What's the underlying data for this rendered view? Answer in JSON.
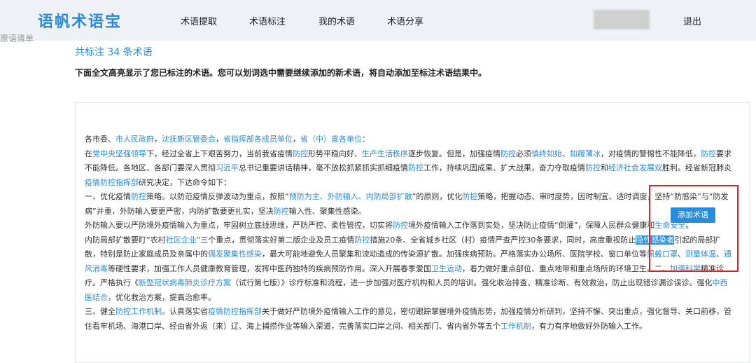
{
  "app": {
    "logo": "语帆术语宝"
  },
  "nav": [
    {
      "label": "术语提取"
    },
    {
      "label": "术语标注"
    },
    {
      "label": "我的术语"
    },
    {
      "label": "术语分享"
    }
  ],
  "header": {
    "logout": "退出"
  },
  "sidebar": {
    "fragment": "原语清单"
  },
  "summary": {
    "count_text": "共标注 34 条术语",
    "instruction": "下面全文高亮显示了您已标注的术语。您可以划词选中需要继续添加的新术语，将自动添加至标注术语结果中。"
  },
  "popup": {
    "add_button": "添加术语"
  },
  "colors": {
    "accent": "#2b8bd8",
    "highlight_box": "#e02020",
    "header_bg": "#eef1f6"
  },
  "document": {
    "paragraphs": [
      [
        {
          "t": "各市委、"
        },
        {
          "t": "市人民政府",
          "h": true
        },
        {
          "t": "，"
        },
        {
          "t": "沈抚新区管委会",
          "h": true
        },
        {
          "t": "，"
        },
        {
          "t": "省指挥部各成员单位",
          "h": true
        },
        {
          "t": "，"
        },
        {
          "t": "省（中）直各单位",
          "h": true
        },
        {
          "t": "："
        }
      ],
      [
        {
          "t": "在"
        },
        {
          "t": "党中央坚强领导",
          "h": true
        },
        {
          "t": "下，经过全省上下艰苦努力，当前我省疫情"
        },
        {
          "t": "防控",
          "h": true
        },
        {
          "t": "形势平稳向好、"
        },
        {
          "t": "生产生活秩序",
          "h": true
        },
        {
          "t": "逐步恢复。但是，加强疫情"
        },
        {
          "t": "防控",
          "h": true
        },
        {
          "t": "必须"
        },
        {
          "t": "慎终如始",
          "h": true
        },
        {
          "t": "、"
        },
        {
          "t": "如履薄冰",
          "h": true
        },
        {
          "t": "，对疫情的警惕性不能降低，"
        },
        {
          "t": "防控",
          "h": true
        },
        {
          "t": "要求不能降低。各地区、各部门要深入贯彻"
        },
        {
          "t": "习近平",
          "h": true
        },
        {
          "t": "总书记重要讲话精神，毫不放松抓紧抓实抓细疫情"
        },
        {
          "t": "防控",
          "h": true
        },
        {
          "t": "工作，持续巩固成果、扩大战果，奋力夺取疫情"
        },
        {
          "t": "防控",
          "h": true
        },
        {
          "t": "和"
        },
        {
          "t": "经济社会发展双",
          "h": true
        },
        {
          "t": "胜利。经省新冠肺炎"
        },
        {
          "t": "疫情防控指挥部",
          "h": true
        },
        {
          "t": "研究决定，下达命令如下："
        }
      ],
      [
        {
          "t": "一、优化疫情"
        },
        {
          "t": "防控",
          "h": true
        },
        {
          "t": "策略。以防范疫情反弹波动为重点，按照“"
        },
        {
          "t": "预防为主、外防输入、内防局部扩散",
          "h": true
        },
        {
          "t": "”的原则，优化"
        },
        {
          "t": "防控",
          "h": true
        },
        {
          "t": "策略，把握动态、审时度势，因时制宜、适时调度，坚持“防感染”与“防发病”并重，外防输入要更严密，内防扩散要更扎实，坚决"
        },
        {
          "t": "防控",
          "h": true
        },
        {
          "t": "输入性、聚集性感染。"
        }
      ],
      [
        {
          "t": "外防输入要以严防境外疫情输入为重点，牢固树立底线思维，严防严控、柔性管控，切实将"
        },
        {
          "t": "防控",
          "h": true
        },
        {
          "t": "境外疫情输入工作落到实处，坚决防止疫情“倒灌”，保障人民群众健康和"
        },
        {
          "t": "生命安全",
          "h": true
        },
        {
          "t": "。"
        }
      ],
      [
        {
          "t": "内防局部扩散要盯“农村"
        },
        {
          "t": "社区企业",
          "h": true
        },
        {
          "t": "”三个重点，贯彻落实好第二版企业及员工疫情"
        },
        {
          "t": "防控",
          "h": true
        },
        {
          "t": "措施20条、全省城乡社区（村）疫情严查严控30条要求，同时，高度重视防止"
        },
        {
          "t": "隐性感染者",
          "s": true
        },
        {
          "t": "引起的局部扩散，特别是防止家庭成员及亲属中的"
        },
        {
          "t": "偶发聚集性感染",
          "h": true
        },
        {
          "t": "，最大可能地避免人员聚集和流动造成的传染源扩散。加强疾病预防。严格落实办公场所、医院学校、窗口单位等"
        },
        {
          "t": "佩戴口罩",
          "h": true
        },
        {
          "t": "、"
        },
        {
          "t": "测量体温",
          "h": true
        },
        {
          "t": "、"
        },
        {
          "t": "通风消毒",
          "h": true
        },
        {
          "t": "等硬性要求，加强工作人员健康教育管理，发挥中医药独特的疾病预防作用。深入开展春季爱国"
        },
        {
          "t": "卫生运动",
          "h": true
        },
        {
          "t": "，着力做好重点部位、重点地带和重点场所的环境卫生。二、"
        },
        {
          "t": "加强科学",
          "h": true
        },
        {
          "t": "精准诊疗。严格执行《"
        },
        {
          "t": "新型冠状病毒肺炎诊疗方案",
          "h": true
        },
        {
          "t": "（试行第七版）》诊疗标准和流程，进一步加强对医疗机构和人员的培训。强化收治排查、精准诊断、有效救治，防止出现错诊漏诊误诊。强化"
        },
        {
          "t": "中西医结合",
          "h": true
        },
        {
          "t": "，优化救治方案，提高治愈率。"
        }
      ],
      [
        {
          "t": "三、健全"
        },
        {
          "t": "防控工作机制",
          "h": true
        },
        {
          "t": "。认真落实省"
        },
        {
          "t": "疫情防控指挥部",
          "h": true
        },
        {
          "t": "关于做好严防境外疫情输入工作的意见，密切跟踪掌握境外疫情形势，加强疫情分析研判，坚持不懈、突出重点，强化督导、关口前移，管住看牢机场、海港口岸、经由省外返（来）辽、海上捕捞作业等输入渠道，完善落实口岸之间、相关部门、省内省外等五个"
        },
        {
          "t": "工作机制",
          "h": true
        },
        {
          "t": "，有力有序地做好外防输入工作。"
        }
      ]
    ]
  }
}
